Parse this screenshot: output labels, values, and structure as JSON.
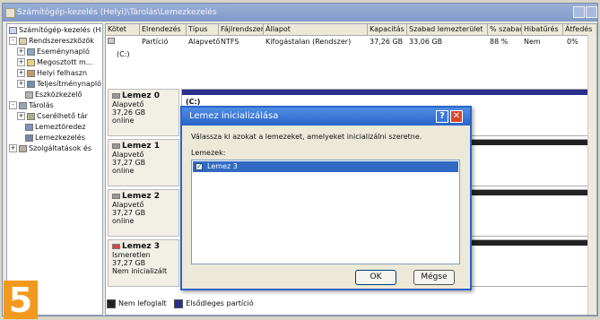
{
  "window": {
    "title": "Számítógép-kezelés (Helyi)\\Tárolás\\Lemezkezelés"
  },
  "tree": {
    "items": [
      {
        "label": "Számítógép-kezelés (H",
        "level": 0
      },
      {
        "label": "Rendszereszközök",
        "level": 1
      },
      {
        "label": "Eseménynapló",
        "level": 2
      },
      {
        "label": "Megosztott m...",
        "level": 2
      },
      {
        "label": "Helyi felhaszn",
        "level": 2
      },
      {
        "label": "Teljesítménynapló",
        "level": 2
      },
      {
        "label": "Eszközkezelő",
        "level": 2
      },
      {
        "label": "Tárolás",
        "level": 1
      },
      {
        "label": "Cserélhető tár",
        "level": 2
      },
      {
        "label": "Lemeztöredez",
        "level": 2
      },
      {
        "label": "Lemezkezelés",
        "level": 2
      },
      {
        "label": "Szolgáltatások és",
        "level": 1
      }
    ]
  },
  "table": {
    "headers": [
      "Kötet",
      "Elrendezés",
      "Típus",
      "Fájlrendszer",
      "Állapot",
      "Kapacitás",
      "Szabad lemezterület",
      "% szabad",
      "Hibatűrés",
      "Átfedés"
    ],
    "row": [
      "(C:)",
      "Partíció",
      "Alapvető",
      "NTFS",
      "Kifogástalan (Rendszer)",
      "37,26 GB",
      "33,06 GB",
      "88 %",
      "Nem",
      "0%"
    ]
  },
  "disks": [
    {
      "name": "Lemez 0",
      "type": "Alapvető",
      "size": "37,26 GB",
      "status": "online",
      "partition": "(C:)"
    },
    {
      "name": "Lemez 1",
      "type": "Alapvető",
      "size": "37,27 GB",
      "status": "online"
    },
    {
      "name": "Lemez 2",
      "type": "Alapvető",
      "size": "37,27 GB",
      "status": "online"
    },
    {
      "name": "Lemez 3",
      "type": "Ismeretlen",
      "size": "37,27 GB",
      "status": "Nem inicializált"
    }
  ],
  "legend": {
    "unallocated": "Nem lefoglalt",
    "primary": "Elsődleges partíció",
    "unallocated_color": "#222222",
    "primary_color": "#2b2f8c"
  },
  "dialog": {
    "title": "Lemez inicializálása",
    "description": "Válassza ki azokat a lemezeket, amelyeket inicializálni szeretne.",
    "list_label": "Lemezek:",
    "items": [
      {
        "label": "Lemez 3",
        "checked": true
      }
    ],
    "ok": "OK",
    "cancel": "Mégse"
  },
  "step_badge": "5",
  "colors": {
    "accent": "#2a64c9",
    "badge": "#f29a1d"
  }
}
